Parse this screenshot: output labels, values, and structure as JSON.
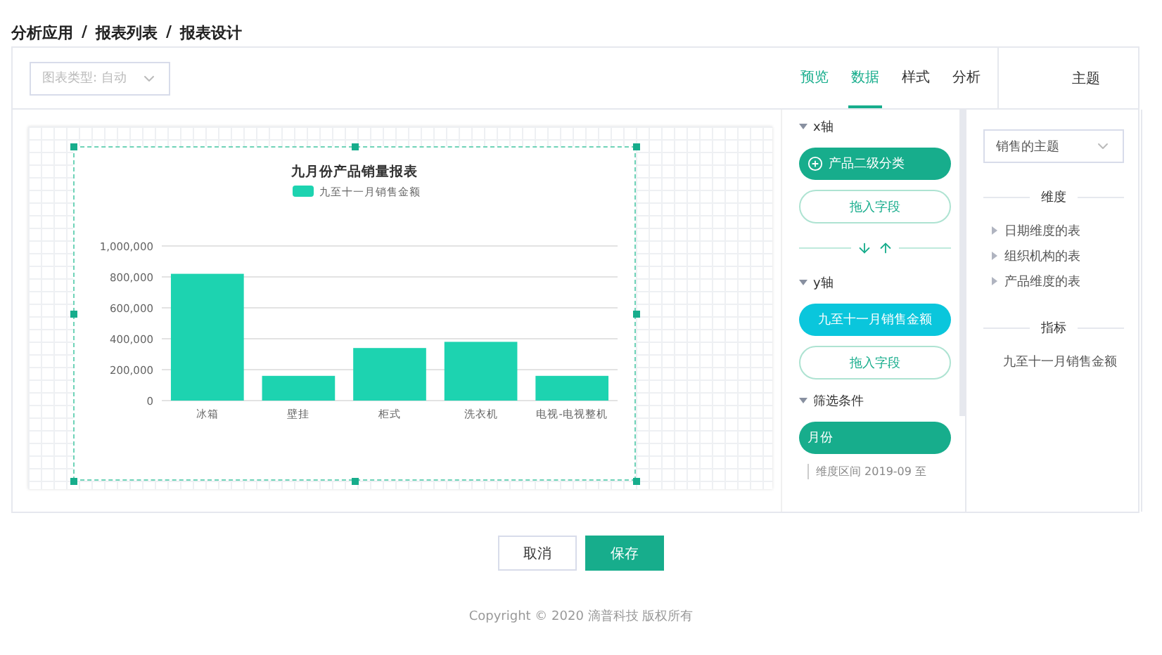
{
  "breadcrumb": {
    "items": [
      "分析应用",
      "报表列表",
      "报表设计"
    ],
    "separator": "/"
  },
  "toolbar": {
    "chart_type_select": {
      "placeholder": "图表类型: 自动"
    },
    "tabs": [
      {
        "label": "预览",
        "kind": "action",
        "selected": false
      },
      {
        "label": "数据",
        "kind": "tab",
        "selected": true
      },
      {
        "label": "样式",
        "kind": "tab",
        "selected": false
      },
      {
        "label": "分析",
        "kind": "tab",
        "selected": false
      }
    ],
    "side_title": "主题"
  },
  "chart": {
    "chart_data": {
      "type": "bar",
      "title": "九月份产品销量报表",
      "categories": [
        "冰箱",
        "壁挂",
        "柜式",
        "洗衣机",
        "电视-电视整机"
      ],
      "series": [
        {
          "name": "九至十一月销售金额",
          "color": "#1dd3b0",
          "values": [
            820000,
            160000,
            340000,
            380000,
            160000
          ]
        }
      ],
      "grid": true,
      "ylim": [
        0,
        1000000
      ],
      "yticks": [
        {
          "value": 0,
          "label": "0"
        },
        {
          "value": 200000,
          "label": "200,000"
        },
        {
          "value": 400000,
          "label": "400,000"
        },
        {
          "value": 600000,
          "label": "600,000"
        },
        {
          "value": 800000,
          "label": "800,000"
        },
        {
          "value": 1000000,
          "label": "1,000,000"
        }
      ]
    }
  },
  "data_panel": {
    "sections": [
      {
        "title": "x轴",
        "expanded": true,
        "fields": [
          {
            "label": "产品二级分类",
            "kind": "dimension",
            "toggle": true
          }
        ],
        "drop_hint": "拖入字段"
      },
      {
        "title": "y轴",
        "expanded": true,
        "fields": [
          {
            "label": "九至十一月销售金额",
            "kind": "measure",
            "toggle": false
          }
        ],
        "drop_hint": "拖入字段"
      },
      {
        "title": "筛选条件",
        "expanded": true,
        "fields": [
          {
            "label": "月份",
            "kind": "dimension",
            "toggle": false
          }
        ],
        "detail": "维度区间 2019-09 至"
      }
    ]
  },
  "theme_panel": {
    "theme_select": {
      "value": "销售的主题"
    },
    "groups": [
      {
        "title": "维度",
        "items": [
          {
            "label": "日期维度的表",
            "kind": "folder"
          },
          {
            "label": "组织机构的表",
            "kind": "folder"
          },
          {
            "label": "产品维度的表",
            "kind": "folder"
          }
        ]
      },
      {
        "title": "指标",
        "items": [
          {
            "label": "九至十一月销售金额",
            "kind": "field"
          }
        ]
      }
    ]
  },
  "actions": [
    {
      "label": "取消",
      "kind": "secondary"
    },
    {
      "label": "保存",
      "kind": "primary"
    }
  ],
  "footer": "Copyright © 2020 滴普科技 版权所有"
}
